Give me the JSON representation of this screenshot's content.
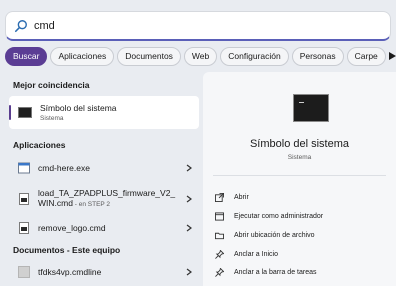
{
  "search": {
    "value": "cmd"
  },
  "filters": [
    "Buscar",
    "Aplicaciones",
    "Documentos",
    "Web",
    "Configuración",
    "Personas",
    "Carpe"
  ],
  "sections": {
    "best": "Mejor coincidencia",
    "apps": "Aplicaciones",
    "docs": "Documentos - Este equipo"
  },
  "best_match": {
    "title": "Símbolo del sistema",
    "subtitle": "Sistema"
  },
  "apps": [
    {
      "name": "cmd-here.exe",
      "sub": ""
    },
    {
      "name": "load_TA_ZPADPLUS_firmware_V2_",
      "name2": "WIN.cmd",
      "sub": " - en STEP 2"
    },
    {
      "name": "remove_logo.cmd",
      "sub": ""
    }
  ],
  "docs": [
    {
      "name": "tfdks4vp.cmdline"
    }
  ],
  "detail": {
    "title": "Símbolo del sistema",
    "subtitle": "Sistema",
    "actions": [
      "Abrir",
      "Ejecutar como administrador",
      "Abrir ubicación de archivo",
      "Anclar a Inicio",
      "Anclar a la barra de tareas"
    ]
  },
  "colors": {
    "accent": "#5b3d94",
    "focus_line": "#5a5fb8"
  }
}
